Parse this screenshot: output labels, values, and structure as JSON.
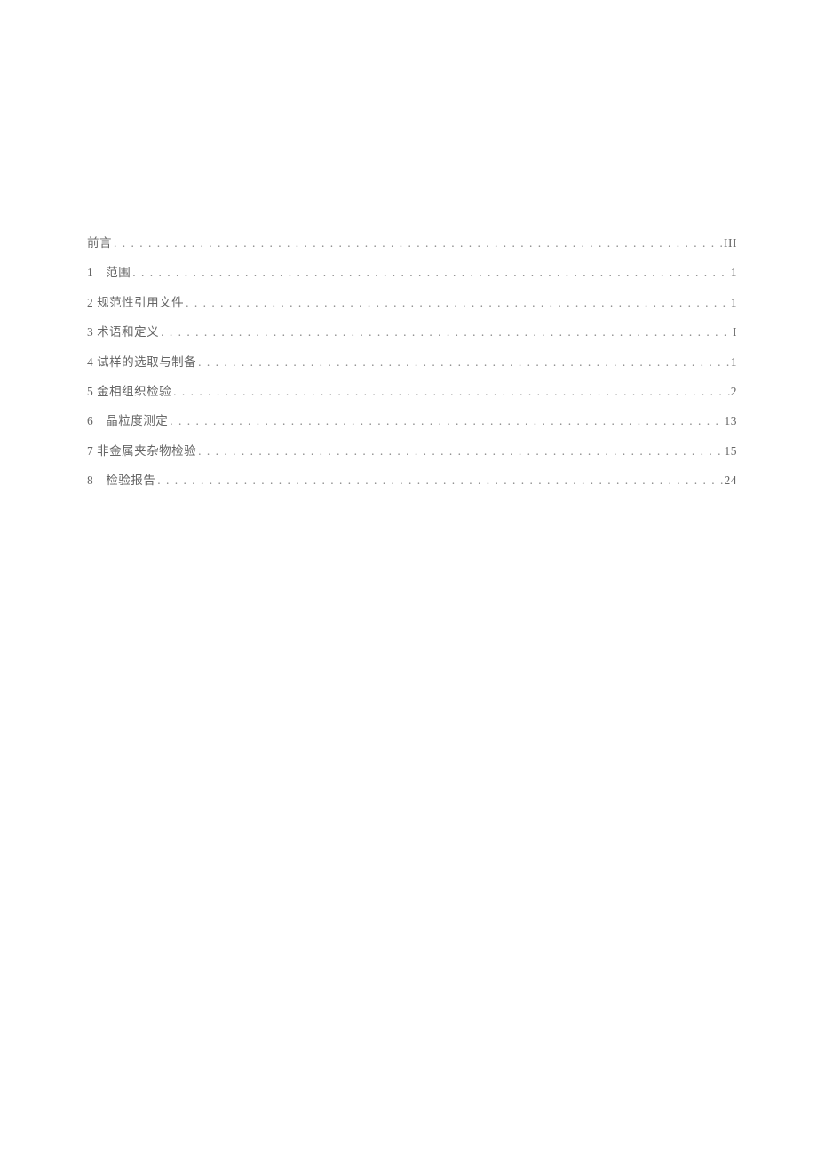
{
  "toc": {
    "entries": [
      {
        "label": "前言",
        "page": "III"
      },
      {
        "label": "1　范围",
        "page": "1"
      },
      {
        "label": "2 规范性引用文件",
        "page": "1"
      },
      {
        "label": "3 术语和定义",
        "page": "I"
      },
      {
        "label": "4 试样的选取与制备",
        "page": "1"
      },
      {
        "label": "5 金相组织检验",
        "page": "2"
      },
      {
        "label": "6　晶粒度测定",
        "page": "13"
      },
      {
        "label": "7 非金属夹杂物检验",
        "page": "15"
      },
      {
        "label": "8　检验报告",
        "page": "24"
      }
    ]
  }
}
